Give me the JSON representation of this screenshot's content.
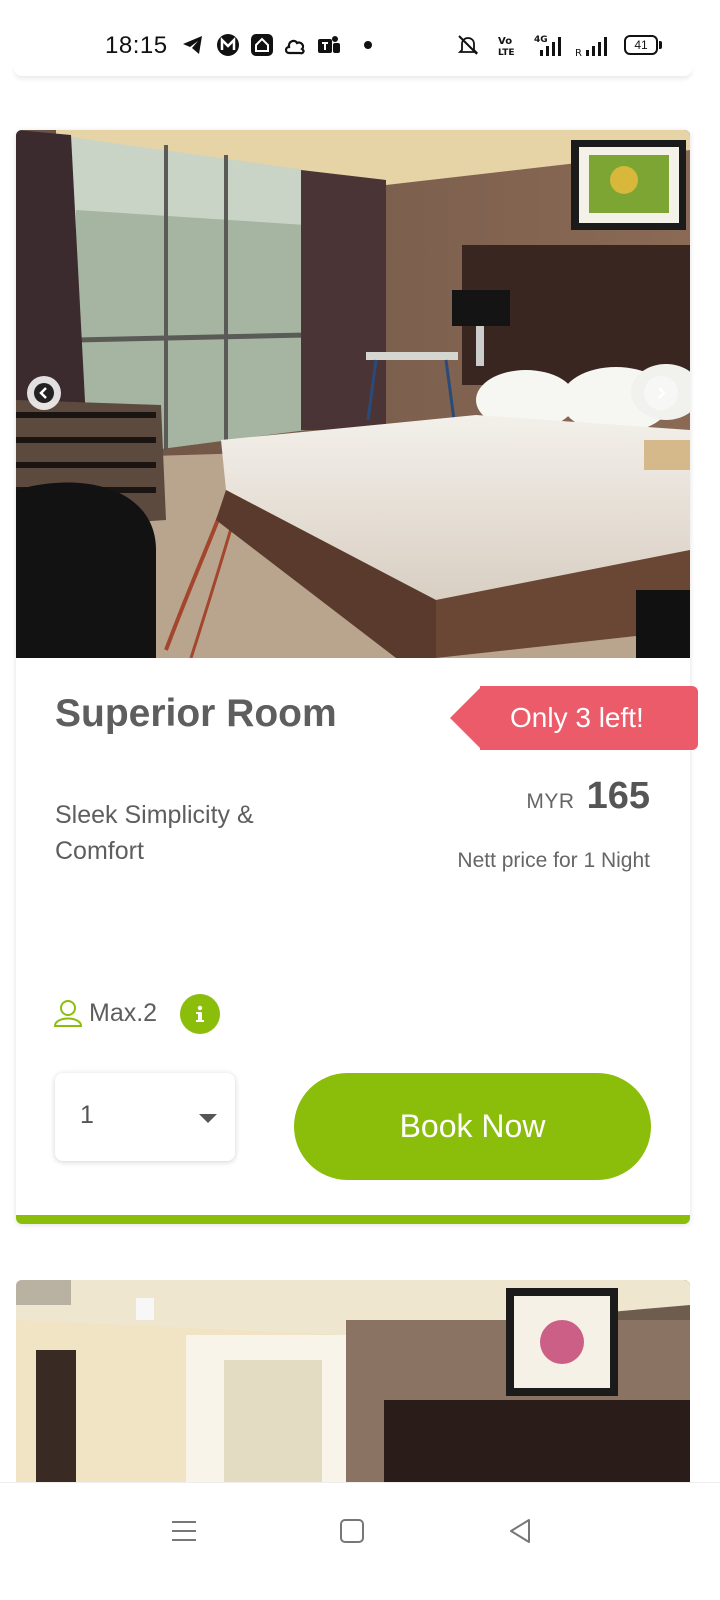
{
  "status_bar": {
    "time": "18:15",
    "battery": "41",
    "icons": [
      "telegram-icon",
      "m-app-icon",
      "home-app-icon",
      "cloud-icon",
      "teams-icon",
      "notification-dot",
      "mute-icon",
      "volte-icon",
      "4g-signal-icon",
      "roaming-signal-icon",
      "battery-icon"
    ]
  },
  "room": {
    "title": "Superior Room",
    "subtitle": "Sleek Simplicity & Comfort",
    "availability_badge": "Only 3 left!",
    "currency": "MYR",
    "price": "165",
    "price_note": "Nett price for 1 Night",
    "occupancy": "Max.2",
    "quantity_selected": "1",
    "book_label": "Book Now",
    "image": "hotel-room-photo",
    "carousel_prev": "chevron-left-icon",
    "carousel_next": "chevron-right-icon"
  },
  "colors": {
    "accent": "#8bbd0b",
    "badge": "#ec5b6a",
    "text": "#5e5e5e"
  },
  "nav_bar": {
    "items": [
      "menu-icon",
      "home-square-icon",
      "back-triangle-icon"
    ]
  }
}
